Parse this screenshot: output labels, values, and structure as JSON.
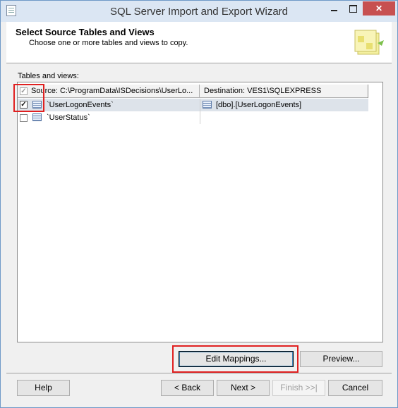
{
  "window": {
    "title": "SQL Server Import and Export Wizard"
  },
  "header": {
    "title": "Select Source Tables and Views",
    "subtitle": "Choose one or more tables and views to copy."
  },
  "grid": {
    "label": "Tables and views:",
    "columns": {
      "source": "Source: C:\\ProgramData\\ISDecisions\\UserLo...",
      "destination": "Destination: VES1\\SQLEXPRESS"
    },
    "rows": [
      {
        "checked": true,
        "source": "`UserLogonEvents`",
        "destination": "[dbo].[UserLogonEvents]"
      },
      {
        "checked": false,
        "source": "`UserStatus`",
        "destination": ""
      }
    ]
  },
  "buttons": {
    "edit_mappings": "Edit Mappings...",
    "preview": "Preview...",
    "help": "Help",
    "back": "< Back",
    "next": "Next >",
    "finish": "Finish >>|",
    "cancel": "Cancel"
  },
  "colors": {
    "highlight_box": "#e02020",
    "selected_row": "#dde3ea"
  }
}
